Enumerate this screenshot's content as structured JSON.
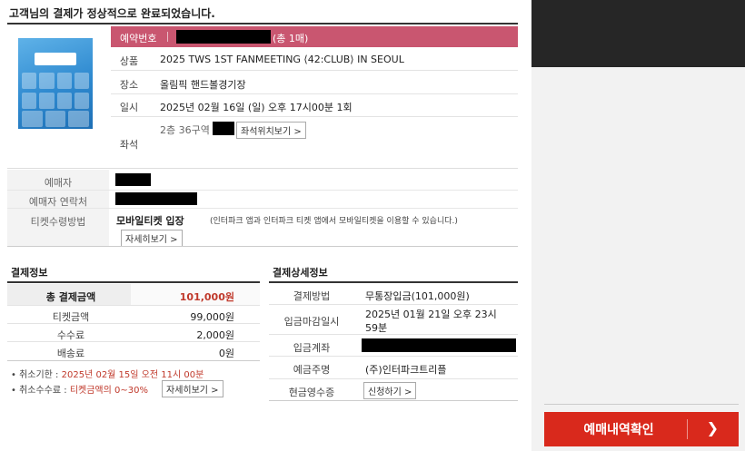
{
  "headline": "고객님의 결제가 정상적으로 완료되었습니다.",
  "reservation": {
    "label": "예약번호",
    "count": "(총 1매)"
  },
  "details": {
    "product_label": "상품",
    "product_value": "2025 TWS 1ST FANMEETING ⟨42:CLUB⟩ IN SEOUL",
    "venue_label": "장소",
    "venue_value": "올림픽 핸드볼경기장",
    "date_label": "일시",
    "date_value": "2025년 02월 16일 (일) 오후 17시00분 1회",
    "seat_label": "좌석",
    "seat_value": "2층 36구역",
    "seat_button": "좌석위치보기 >"
  },
  "buyer": {
    "name_label": "예매자",
    "contact_label": "예매자 연락처",
    "ticket_method_label": "티켓수령방법",
    "ticket_method_value": "모바일티켓 입장",
    "ticket_method_desc": "(인터파크 앱과 인터파크 티켓 앱에서 모바일티켓을 이용할 수 있습니다.)",
    "detail_button": "자세히보기 >"
  },
  "payment_info": {
    "title": "결제정보",
    "rows": [
      {
        "label": "총 결제금액",
        "value": "101,000원"
      },
      {
        "label": "티켓금액",
        "value": "99,000원"
      },
      {
        "label": "수수료",
        "value": "2,000원"
      },
      {
        "label": "배송료",
        "value": "0원"
      }
    ],
    "total_color": "#c0392b"
  },
  "notes": {
    "cancel_deadline_label": "취소기한 :",
    "cancel_deadline_value": "2025년 02월 15일 오전 11시 00분",
    "cancel_fee_label": "취소수수료 :",
    "cancel_fee_value": "티켓금액의 0~30%",
    "cancel_fee_button": "자세히보기 >"
  },
  "payment_detail": {
    "title": "결제상세정보",
    "method_label": "결제방법",
    "method_value": "무통장입금(101,000원)",
    "deadline_label": "입금마감일시",
    "deadline_value_line1": "2025년 01월 21일 오후 23시",
    "deadline_value_line2": "59분",
    "account_label": "입금계좌",
    "depositor_label": "예금주명",
    "depositor_value": "(주)인터파크트리플",
    "receipt_label": "현금영수증",
    "receipt_button": "신청하기 >"
  },
  "confirm_button": "예매내역확인",
  "colors": {
    "accent_bar": "#c95670",
    "confirm_button": "#d9291c",
    "right_header": "#262626"
  }
}
